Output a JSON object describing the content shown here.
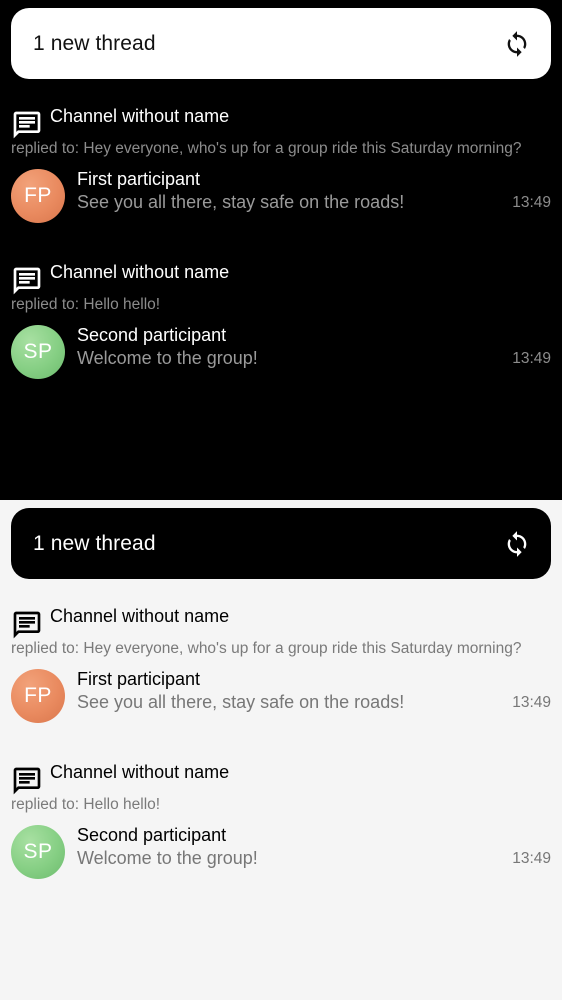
{
  "panels": [
    {
      "theme": "dark",
      "banner": {
        "label": "1 new thread",
        "icon": "refresh-icon"
      },
      "threads": [
        {
          "channel_name": "Channel without name",
          "replied_to": "replied to: Hey everyone, who's up for a group ride this Saturday morning?",
          "avatar_initials": "FP",
          "author": "First participant",
          "message": "See you all there, stay safe on the roads!",
          "time": "13:49"
        },
        {
          "channel_name": "Channel without name",
          "replied_to": "replied to: Hello hello!",
          "avatar_initials": "SP",
          "author": "Second participant",
          "message": "Welcome to the group!",
          "time": "13:49"
        }
      ]
    },
    {
      "theme": "light",
      "banner": {
        "label": "1 new thread",
        "icon": "refresh-icon"
      },
      "threads": [
        {
          "channel_name": "Channel without name",
          "replied_to": "replied to: Hey everyone, who's up for a group ride this Saturday morning?",
          "avatar_initials": "FP",
          "author": "First participant",
          "message": "See you all there, stay safe on the roads!",
          "time": "13:49"
        },
        {
          "channel_name": "Channel without name",
          "replied_to": "replied to: Hello hello!",
          "avatar_initials": "SP",
          "author": "Second participant",
          "message": "Welcome to the group!",
          "time": "13:49"
        }
      ]
    }
  ],
  "colors": {
    "dark_background": "#000000",
    "light_background": "#f5f5f5",
    "fp_avatar": "#e98a5f",
    "sp_avatar": "#86cf84"
  }
}
